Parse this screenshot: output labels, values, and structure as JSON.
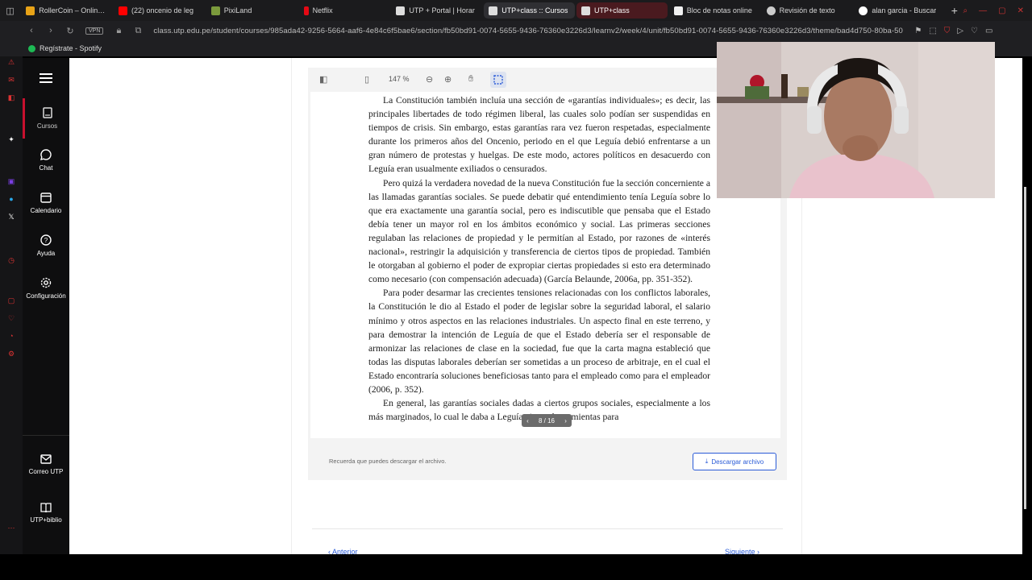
{
  "tabs": [
    {
      "label": "RollerCoin – Online B",
      "color": "#e8a317"
    },
    {
      "label": "(22) oncenio de leg",
      "color": "#ff0000"
    },
    {
      "label": "PixiLand",
      "color": "#7b9a3c"
    },
    {
      "label": "Netflix",
      "color": "#e50914"
    },
    {
      "label": "UTP + Portal | Horar",
      "color": "#dddddd"
    },
    {
      "label": "UTP+class :: Cursos",
      "color": "#dddddd"
    },
    {
      "label": "UTP+class",
      "color": "#dddddd"
    },
    {
      "label": "Bloc de notas online",
      "color": "#f0f0f0"
    },
    {
      "label": "Revisión de texto",
      "color": "#cccccc"
    },
    {
      "label": "alan garcia - Buscar",
      "color": "#4285f4"
    }
  ],
  "address": {
    "vpn": "VPN",
    "url": "class.utp.edu.pe/student/courses/985ada42-9256-5664-aaf6-4e84c6f5bae6/section/fb50bd91-0074-5655-9436-76360e3226d3/learnv2/week/4/unit/fb50bd91-0074-5655-9436-76360e3226d3/theme/bad4d750-80ba-50b"
  },
  "bookmark": {
    "label": "Regístrate - Spotify"
  },
  "sidebar": {
    "items": [
      {
        "label": "Cursos",
        "icon": "book-icon"
      },
      {
        "label": "Chat",
        "icon": "chat-icon"
      },
      {
        "label": "Calendario",
        "icon": "calendar-icon"
      },
      {
        "label": "Ayuda",
        "icon": "help-icon"
      },
      {
        "label": "Configuración",
        "icon": "gear-icon"
      }
    ],
    "bottom": [
      {
        "label": "Correo UTP",
        "icon": "mail-icon"
      },
      {
        "label": "UTP+biblio",
        "icon": "library-icon"
      }
    ]
  },
  "viewer": {
    "zoom": "147 %",
    "page_indicator": "8 / 16",
    "paragraphs": [
      "La Constitución también incluía una sección de «garantías individuales»; es decir, las principales libertades de todo régimen liberal, las cuales solo podían ser suspendidas en tiempos de crisis. Sin embargo, estas garantías rara vez fueron respetadas, especialmente durante los primeros años del Oncenio, periodo en el que Leguía debió enfrentarse a un gran número de protestas y huelgas. De este modo, actores políticos en desacuerdo con Leguía eran usualmente exiliados o censurados.",
      "Pero quizá la verdadera novedad de la nueva Constitución fue la sección concerniente a las llamadas garantías sociales. Se puede debatir qué entendimiento tenía Leguía sobre lo que era exactamente una garantía social, pero es indiscutible que pensaba que el Estado debía tener un mayor rol en los ámbitos económico y social. Las primeras secciones regulaban las relaciones de propiedad y le permitían al Estado, por razones de «interés nacional», restringir la adquisición y transferencia de ciertos tipos de propiedad. También le otorgaban al gobierno el poder de expropiar ciertas propiedades si esto era determinado como necesario (con compensación adecuada) (García Belaunde, 2006a, pp. 351-352).",
      "Para poder desarmar las crecientes tensiones relacionadas con los conflictos laborales, la Constitución le dio al Estado el poder de legislar sobre la seguridad laboral, el salario mínimo y otros aspectos en las relaciones industriales. Un aspecto final en este terreno, y para demostrar la intención de Leguía de que el Estado debería ser el responsable de armonizar las relaciones de clase en la sociedad, fue que la carta magna estableció que todas las disputas laborales deberían ser sometidas a un proceso de arbitraje, en el cual el Estado encontraría soluciones beneficiosas tanto para el empleado como para el empleador (2006, p. 352).",
      "En general, las garantías sociales                 dadas a ciertos grupos sociales, especialmente a los más marginados, lo cual le daba a Leguía ciertas herramientas para"
    ],
    "download_note": "Recuerda que puedes descargar el archivo.",
    "download_label": "Descargar archivo"
  },
  "navigation": {
    "prev": "Anterior",
    "next": "Siguiente"
  }
}
